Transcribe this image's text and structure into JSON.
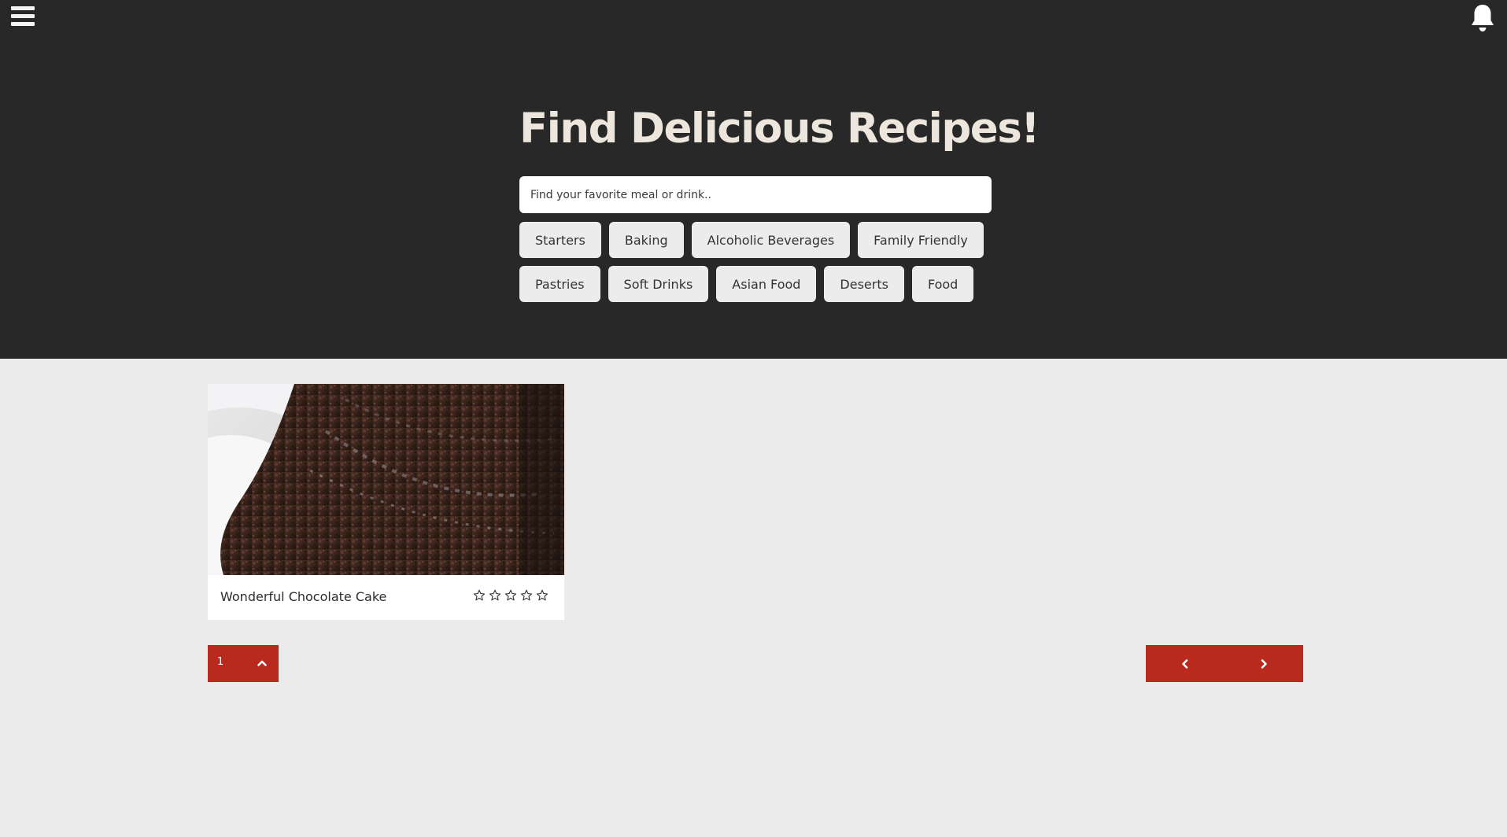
{
  "header": {
    "menu_icon": "hamburger-menu-icon",
    "notification_icon": "bell-icon",
    "title": "Find Delicious Recipes!",
    "search": {
      "placeholder": "Find your favorite meal or drink..",
      "value": ""
    }
  },
  "categories": {
    "row1": [
      "Starters",
      "Baking",
      "Alcoholic Beverages",
      "Family Friendly"
    ],
    "row2": [
      "Pastries",
      "Soft Drinks",
      "Asian Food",
      "Deserts",
      "Food"
    ]
  },
  "recipes": [
    {
      "title": "Wonderful Chocolate Cake",
      "rating": 0,
      "rating_max": 5,
      "image": "chocolate-cake-slice"
    }
  ],
  "pagination": {
    "page_size": "1",
    "page_size_icon": "chevron-up-icon",
    "prev_icon": "chevron-left-icon",
    "next_icon": "chevron-right-icon"
  },
  "colors": {
    "hero_bg": "#282828",
    "page_bg": "#ecebec",
    "accent": "#b82a1e",
    "title": "#ece6dc"
  }
}
